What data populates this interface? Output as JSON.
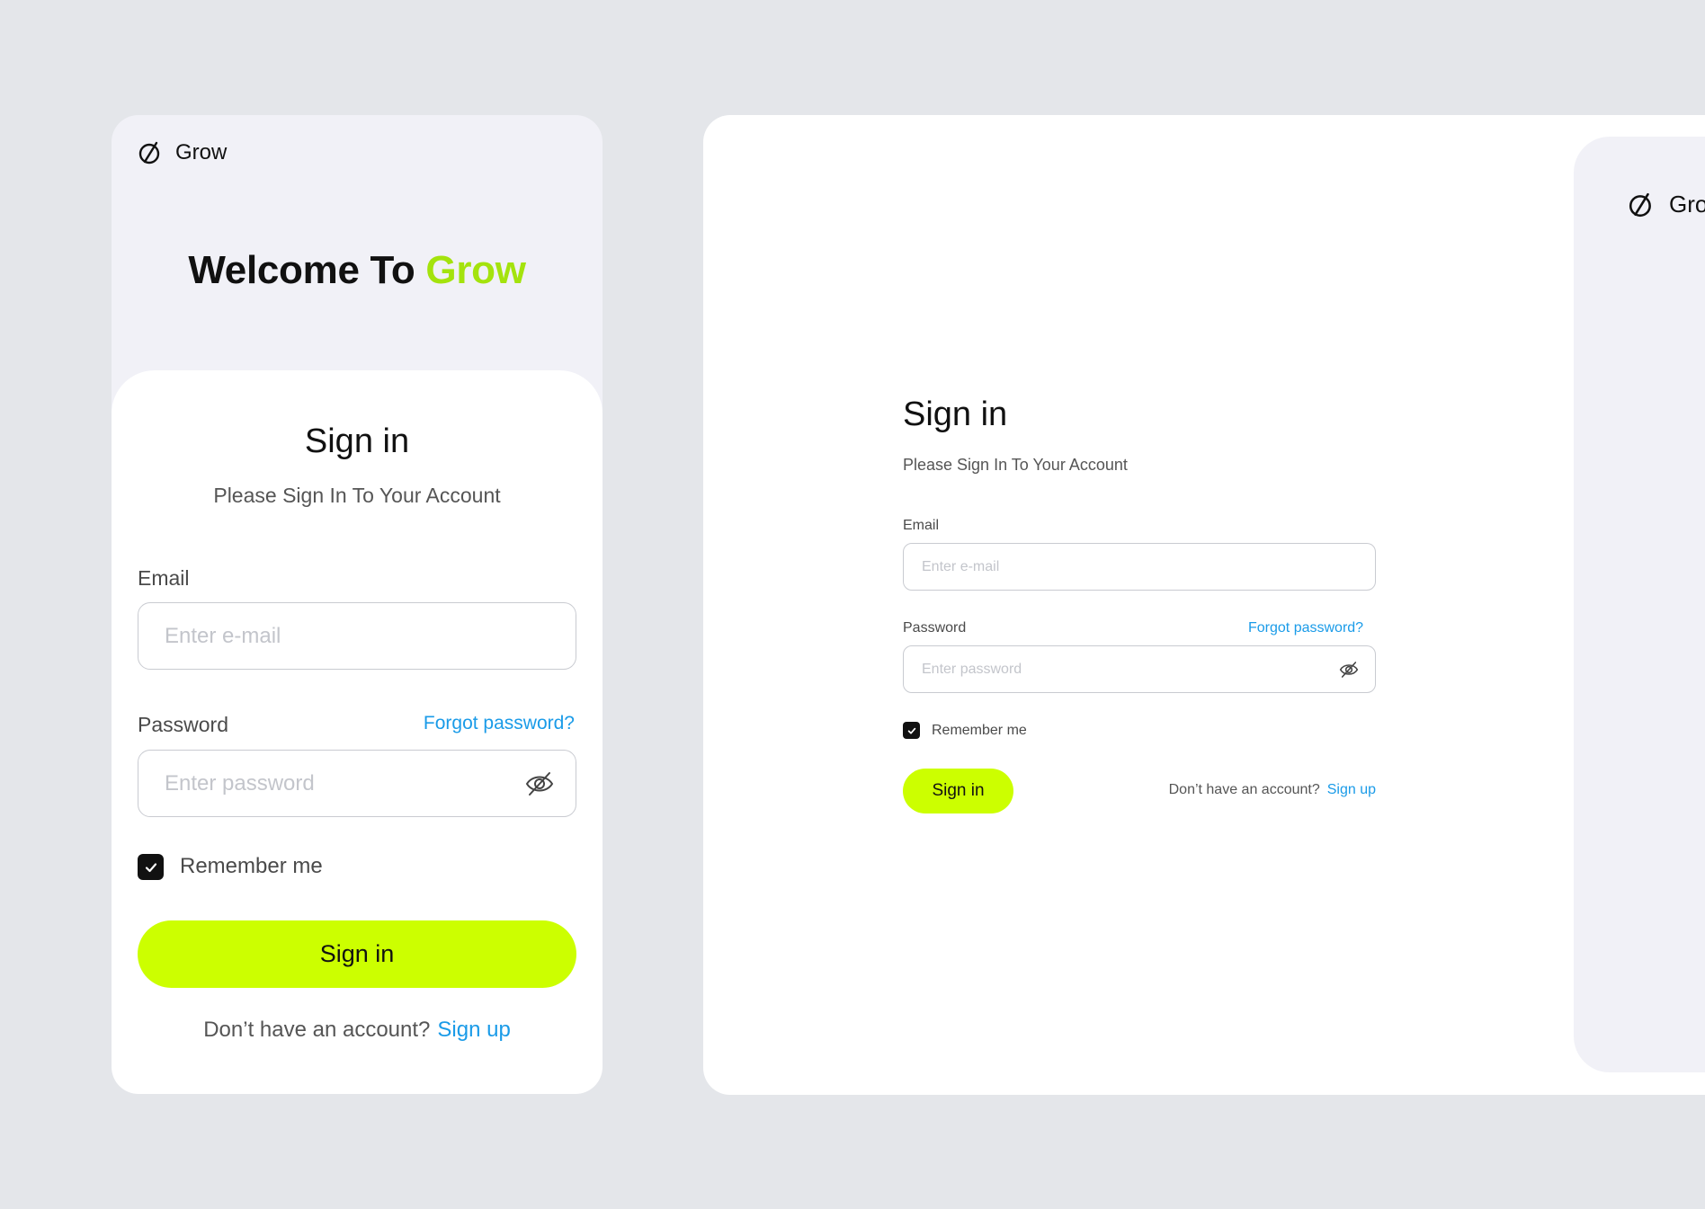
{
  "brand": {
    "name": "Grow",
    "logo_icon": "slashed-circle-logo-icon"
  },
  "colors": {
    "accent_lime": "#ccff00",
    "accent_green_text": "#a4e30d",
    "link_blue": "#1a9be8",
    "background": "#e4e6ea"
  },
  "mobile": {
    "welcome_prefix": "Welcome To",
    "welcome_accent": "Grow",
    "title": "Sign in",
    "subtitle": "Please Sign In To Your Account",
    "email_label": "Email",
    "email_placeholder": "Enter e-mail",
    "password_label": "Password",
    "forgot_link": "Forgot password?",
    "password_placeholder": "Enter password",
    "remember_label": "Remember me",
    "remember_checked": true,
    "signin_button": "Sign in",
    "footer_text": "Don’t have an account?",
    "signup_link": "Sign up"
  },
  "desktop": {
    "title": "Sign in",
    "subtitle": "Please Sign In To Your Account",
    "email_label": "Email",
    "email_placeholder": "Enter e-mail",
    "password_label": "Password",
    "forgot_link": "Forgot password?",
    "password_placeholder": "Enter password",
    "remember_label": "Remember me",
    "remember_checked": true,
    "signin_button": "Sign in",
    "footer_text": "Don’t have an account?",
    "signup_link": "Sign up",
    "side_brand_name": "Grow"
  }
}
